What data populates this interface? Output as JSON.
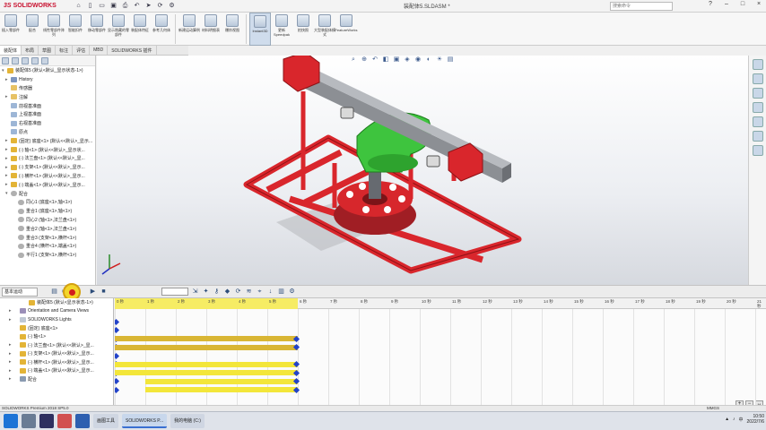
{
  "app": {
    "brand_prefix": "3S",
    "brand": "SOLIDWORKS",
    "doc_title": "装配体5.SLDASM *",
    "search_placeholder": "搜索命令",
    "status_text": "SOLIDWORKS Premium 2018 SP5.0",
    "units": "MMGS",
    "colors": {
      "frame_red": "#d9262c",
      "bracket_green": "#3ec43e",
      "timeline_yellow": "#f3e63a",
      "timeline_gold": "#d9b634",
      "keyframe_blue": "#2343c9"
    }
  },
  "quick_access": [
    "home-icon",
    "new-icon",
    "open-icon",
    "save-icon",
    "print-icon",
    "undo-icon",
    "select-icon",
    "rebuild-icon",
    "options-icon"
  ],
  "command_manager": [
    {
      "label": "插入零部件",
      "icon": "insert-component-icon"
    },
    {
      "label": "配合",
      "icon": "mate-icon"
    },
    {
      "label": "线性零部件阵列",
      "icon": "pattern-icon"
    },
    {
      "label": "智能扣件",
      "icon": "smart-fastener-icon"
    },
    {
      "label": "移动零部件",
      "icon": "move-component-icon"
    },
    {
      "label": "显示隐藏的零部件",
      "icon": "show-hidden-icon"
    },
    {
      "label": "装配体特征",
      "icon": "assembly-feature-icon"
    },
    {
      "label": "参考几何体",
      "icon": "reference-geometry-icon"
    },
    {
      "label": "新建运动算例",
      "icon": "motion-study-icon"
    },
    {
      "label": "材料明细表",
      "icon": "bom-icon"
    },
    {
      "label": "爆炸视图",
      "icon": "explode-icon"
    },
    {
      "label": "Instant3D",
      "icon": "instant3d-icon"
    },
    {
      "label": "更新Speedpak",
      "icon": "speedpak-icon"
    },
    {
      "label": "拍快照",
      "icon": "snapshot-icon"
    },
    {
      "label": "大型装配体模式",
      "icon": "large-assembly-icon"
    },
    {
      "label": "FeatureWorks",
      "icon": "featureworks-icon"
    }
  ],
  "tabs": [
    "装配体",
    "布局",
    "草图",
    "标注",
    "评估",
    "MBD",
    "SOLIDWORKS 插件"
  ],
  "feature_tree": [
    {
      "label": "装配体5 (默认<默认_显示状态-1>)",
      "kind": "asm",
      "exp": "▾"
    },
    {
      "label": "History",
      "kind": "hist",
      "exp": "▸"
    },
    {
      "label": "传感器",
      "kind": "folder",
      "exp": ""
    },
    {
      "label": "注解",
      "kind": "folder",
      "exp": "▸"
    },
    {
      "label": "前视基准面",
      "kind": "plane",
      "exp": ""
    },
    {
      "label": "上视基准面",
      "kind": "plane",
      "exp": ""
    },
    {
      "label": "右视基准面",
      "kind": "plane",
      "exp": ""
    },
    {
      "label": "原点",
      "kind": "plane",
      "exp": ""
    },
    {
      "label": "(固定) 底座<1> (默认<<默认>_显示...",
      "kind": "part",
      "exp": "▸"
    },
    {
      "label": "(-) 轴<1> (默认<<默认>_显示状...",
      "kind": "part",
      "exp": "▸"
    },
    {
      "label": "(-) 法兰盘<1> (默认<<默认>_显...",
      "kind": "part",
      "exp": "▸"
    },
    {
      "label": "(-) 支架<1> (默认<<默认>_显示...",
      "kind": "part",
      "exp": "▸"
    },
    {
      "label": "(-) 横杆<1> (默认<<默认>_显示...",
      "kind": "part",
      "exp": "▸"
    },
    {
      "label": "(-) 端盖<1> (默认<<默认>_显示...",
      "kind": "part",
      "exp": "▸"
    },
    {
      "label": "配合",
      "kind": "mate",
      "exp": "▾"
    },
    {
      "label": "同心1 (底座<1>,轴<1>)",
      "kind": "mate",
      "exp": ""
    },
    {
      "label": "重合1 (底座<1>,轴<1>)",
      "kind": "mate",
      "exp": ""
    },
    {
      "label": "同心2 (轴<1>,法兰盘<1>)",
      "kind": "mate",
      "exp": ""
    },
    {
      "label": "重合2 (轴<1>,法兰盘<1>)",
      "kind": "mate",
      "exp": ""
    },
    {
      "label": "重合3 (支架<1>,横杆<1>)",
      "kind": "mate",
      "exp": ""
    },
    {
      "label": "重合4 (横杆<1>,端盖<1>)",
      "kind": "mate",
      "exp": ""
    },
    {
      "label": "平行1 (支架<1>,横杆<1>)",
      "kind": "mate",
      "exp": ""
    }
  ],
  "motion": {
    "study_name": "基本运动",
    "study_type": "动画",
    "time_labels": [
      "0 秒",
      "1 秒",
      "2 秒",
      "3 秒",
      "4 秒",
      "5 秒",
      "6 秒",
      "7 秒",
      "8 秒",
      "9 秒",
      "10 秒",
      "11 秒",
      "12 秒",
      "13 秒",
      "14 秒",
      "15 秒",
      "16 秒",
      "17 秒",
      "18 秒",
      "19 秒",
      "20 秒",
      "21 秒"
    ],
    "tree": [
      {
        "label": "装配体5 (默认<显示状态-1>)",
        "kind": "asm",
        "exp": ""
      },
      {
        "label": "Orientation and Camera Views",
        "kind": "view",
        "exp": "▸"
      },
      {
        "label": "SOLIDWORKS Lights",
        "kind": "light",
        "exp": "▸"
      },
      {
        "label": "(固定) 底座<1>",
        "kind": "part",
        "exp": ""
      },
      {
        "label": "(-) 轴<1>",
        "kind": "part",
        "exp": ""
      },
      {
        "label": "(-) 法兰盘<1> (默认<<默认>_显...",
        "kind": "part",
        "exp": "▸"
      },
      {
        "label": "(-) 支架<1> (默认<<默认>_显示...",
        "kind": "part",
        "exp": "▸"
      },
      {
        "label": "(-) 横杆<1> (默认<<默认>_显示...",
        "kind": "part",
        "exp": "▸"
      },
      {
        "label": "(-) 端盖<1> (默认<<默认>_显示...",
        "kind": "part",
        "exp": "▸"
      },
      {
        "label": "配合",
        "kind": "mate",
        "exp": "▸"
      }
    ]
  },
  "taskbar": {
    "apps": [
      "画图工具",
      "SOLIDWORKS P...",
      "我的电脑 (C:)"
    ],
    "time": "10:50",
    "date": "2022/7/6",
    "lang": "中"
  }
}
